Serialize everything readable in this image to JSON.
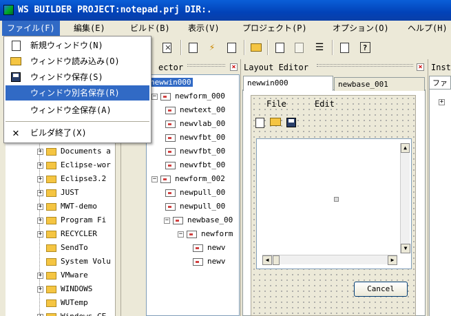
{
  "window": {
    "title": "WS BUILDER PROJECT:notepad.prj DIR:."
  },
  "menubar": {
    "items": [
      "ファイル(F)",
      "編集(E)",
      "ビルド(B)",
      "表示(V)",
      "プロジェクト(P)",
      "オプション(O)",
      "ヘルプ(H)"
    ],
    "active_index": 0
  },
  "file_menu": {
    "items": [
      {
        "label": "新規ウィンドウ(N)",
        "icon": "new-window-icon"
      },
      {
        "label": "ウィンドウ読み込み(O)",
        "icon": "open-folder-icon"
      },
      {
        "label": "ウィンドウ保存(S)",
        "icon": "save-disk-icon"
      },
      {
        "label": "ウィンドウ別名保存(R)",
        "icon": "",
        "highlighted": true
      },
      {
        "label": "ウィンドウ全保存(A)",
        "icon": ""
      },
      {
        "label": "ビルダ終了(X)",
        "icon": "exit-x-icon"
      }
    ]
  },
  "file_tree": {
    "items": [
      "Documents a",
      "Eclipse-wor",
      "Eclipse3.2",
      "JUST",
      "MWT-demo",
      "Program Fi",
      "RECYCLER",
      "SendTo",
      "System Volu",
      "VMware",
      "WINDOWS",
      "WUTemp",
      "Windows CE"
    ]
  },
  "inspector": {
    "header": "ector",
    "items": [
      "newwin000",
      "newform_000",
      "newtext_00",
      "newvlab_00",
      "newvfbt_00",
      "newvfbt_00",
      "newvfbt_00",
      "newform_002",
      "newpull_00",
      "newpull_00",
      "newbase_00",
      "newform",
      "newv",
      "newv"
    ]
  },
  "layout_editor": {
    "header": "Layout Editor",
    "tabs": [
      "newwin000",
      "newbase_001"
    ],
    "active_tab": 0,
    "preview_menu": [
      "File",
      "Edit"
    ],
    "cancel_label": "Cancel"
  },
  "right_panel": {
    "header": "Inst",
    "tab": "ファ"
  },
  "colors": {
    "titlebar": "#0242b8",
    "highlight": "#316ac5",
    "face": "#ece9d8"
  }
}
